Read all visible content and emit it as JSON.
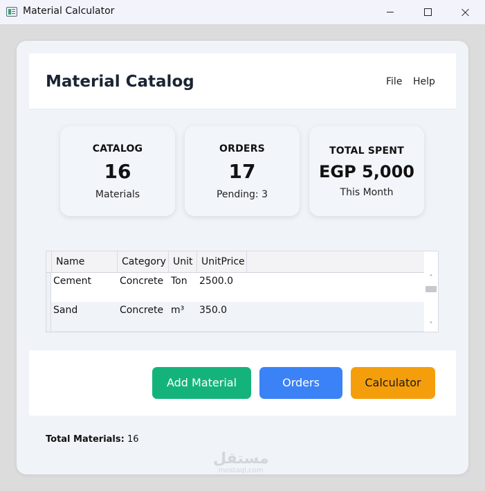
{
  "window": {
    "title": "Material Calculator"
  },
  "header": {
    "title": "Material Catalog",
    "menu": [
      "File",
      "Help"
    ]
  },
  "stats": [
    {
      "label": "CATALOG",
      "value": "16",
      "sub": "Materials"
    },
    {
      "label": "ORDERS",
      "value": "17",
      "sub": "Pending: 3"
    },
    {
      "label": "TOTAL SPENT",
      "value": "EGP 5,000",
      "sub": "This Month"
    }
  ],
  "table": {
    "columns": [
      "Name",
      "Category",
      "Unit",
      "UnitPrice"
    ],
    "rows": [
      [
        "Cement",
        "Concrete",
        "Ton",
        "2500.0"
      ],
      [
        "Sand",
        "Concrete",
        "m³",
        "350.0"
      ]
    ]
  },
  "actions": {
    "add_material": "Add Material",
    "orders": "Orders",
    "calculator": "Calculator"
  },
  "footer": {
    "label": "Total Materials:",
    "value": "16"
  },
  "watermark": {
    "main": "مستقل",
    "sub": "mostaql.com"
  },
  "colors": {
    "add_button": "#15b37c",
    "orders_button": "#3b82f6",
    "calculator_button": "#f59e0b"
  }
}
